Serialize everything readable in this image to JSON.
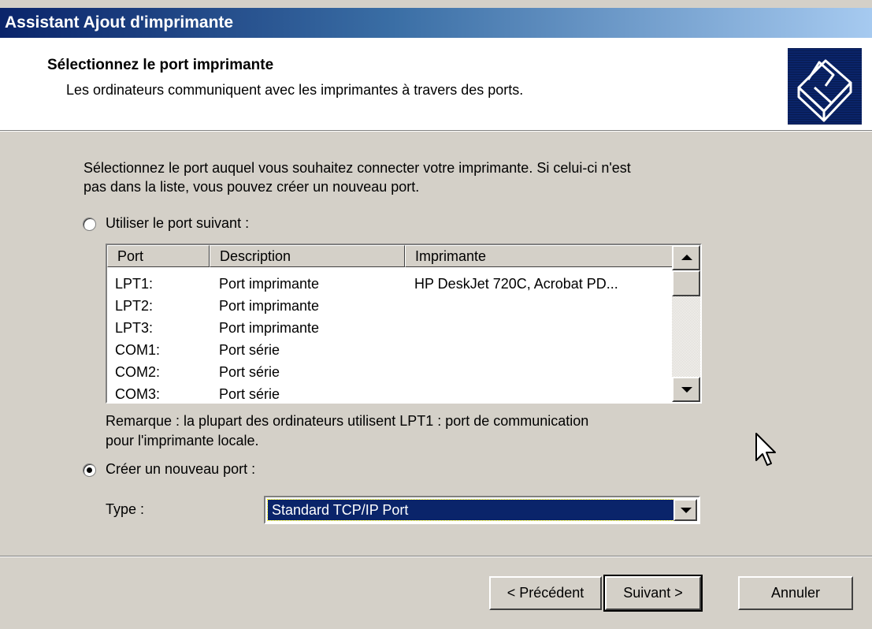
{
  "window": {
    "title": "Assistant Ajout d'imprimante"
  },
  "header": {
    "title": "Sélectionnez le port imprimante",
    "subtitle": "Les ordinateurs communiquent avec les imprimantes à travers des ports.",
    "icon": "printer-icon"
  },
  "body": {
    "intro_line1": "Sélectionnez le port auquel vous souhaitez connecter votre imprimante. Si celui-ci n'est",
    "intro_line2": "pas dans la liste, vous pouvez créer un nouveau port.",
    "radio_existing": {
      "label": "Utiliser le port suivant :",
      "checked": false
    },
    "ports_table": {
      "columns": [
        "Port",
        "Description",
        "Imprimante"
      ],
      "rows": [
        [
          "LPT1:",
          "Port imprimante",
          "HP DeskJet 720C, Acrobat PD..."
        ],
        [
          "LPT2:",
          "Port imprimante",
          ""
        ],
        [
          "LPT3:",
          "Port imprimante",
          ""
        ],
        [
          "COM1:",
          "Port série",
          ""
        ],
        [
          "COM2:",
          "Port série",
          ""
        ],
        [
          "COM3:",
          "Port série",
          ""
        ]
      ]
    },
    "note_line1": "Remarque : la plupart des ordinateurs utilisent LPT1 : port de communication",
    "note_line2": "pour l'imprimante locale.",
    "radio_new": {
      "label": "Créer un nouveau port :",
      "checked": true
    },
    "type_label": "Type :",
    "type_value": "Standard TCP/IP Port"
  },
  "buttons": {
    "back": "< Précédent",
    "next": "Suivant >",
    "cancel": "Annuler"
  },
  "colors": {
    "title_bar": "#0a246a",
    "dialog_bg": "#d4d0c8",
    "selection": "#0a246a"
  }
}
